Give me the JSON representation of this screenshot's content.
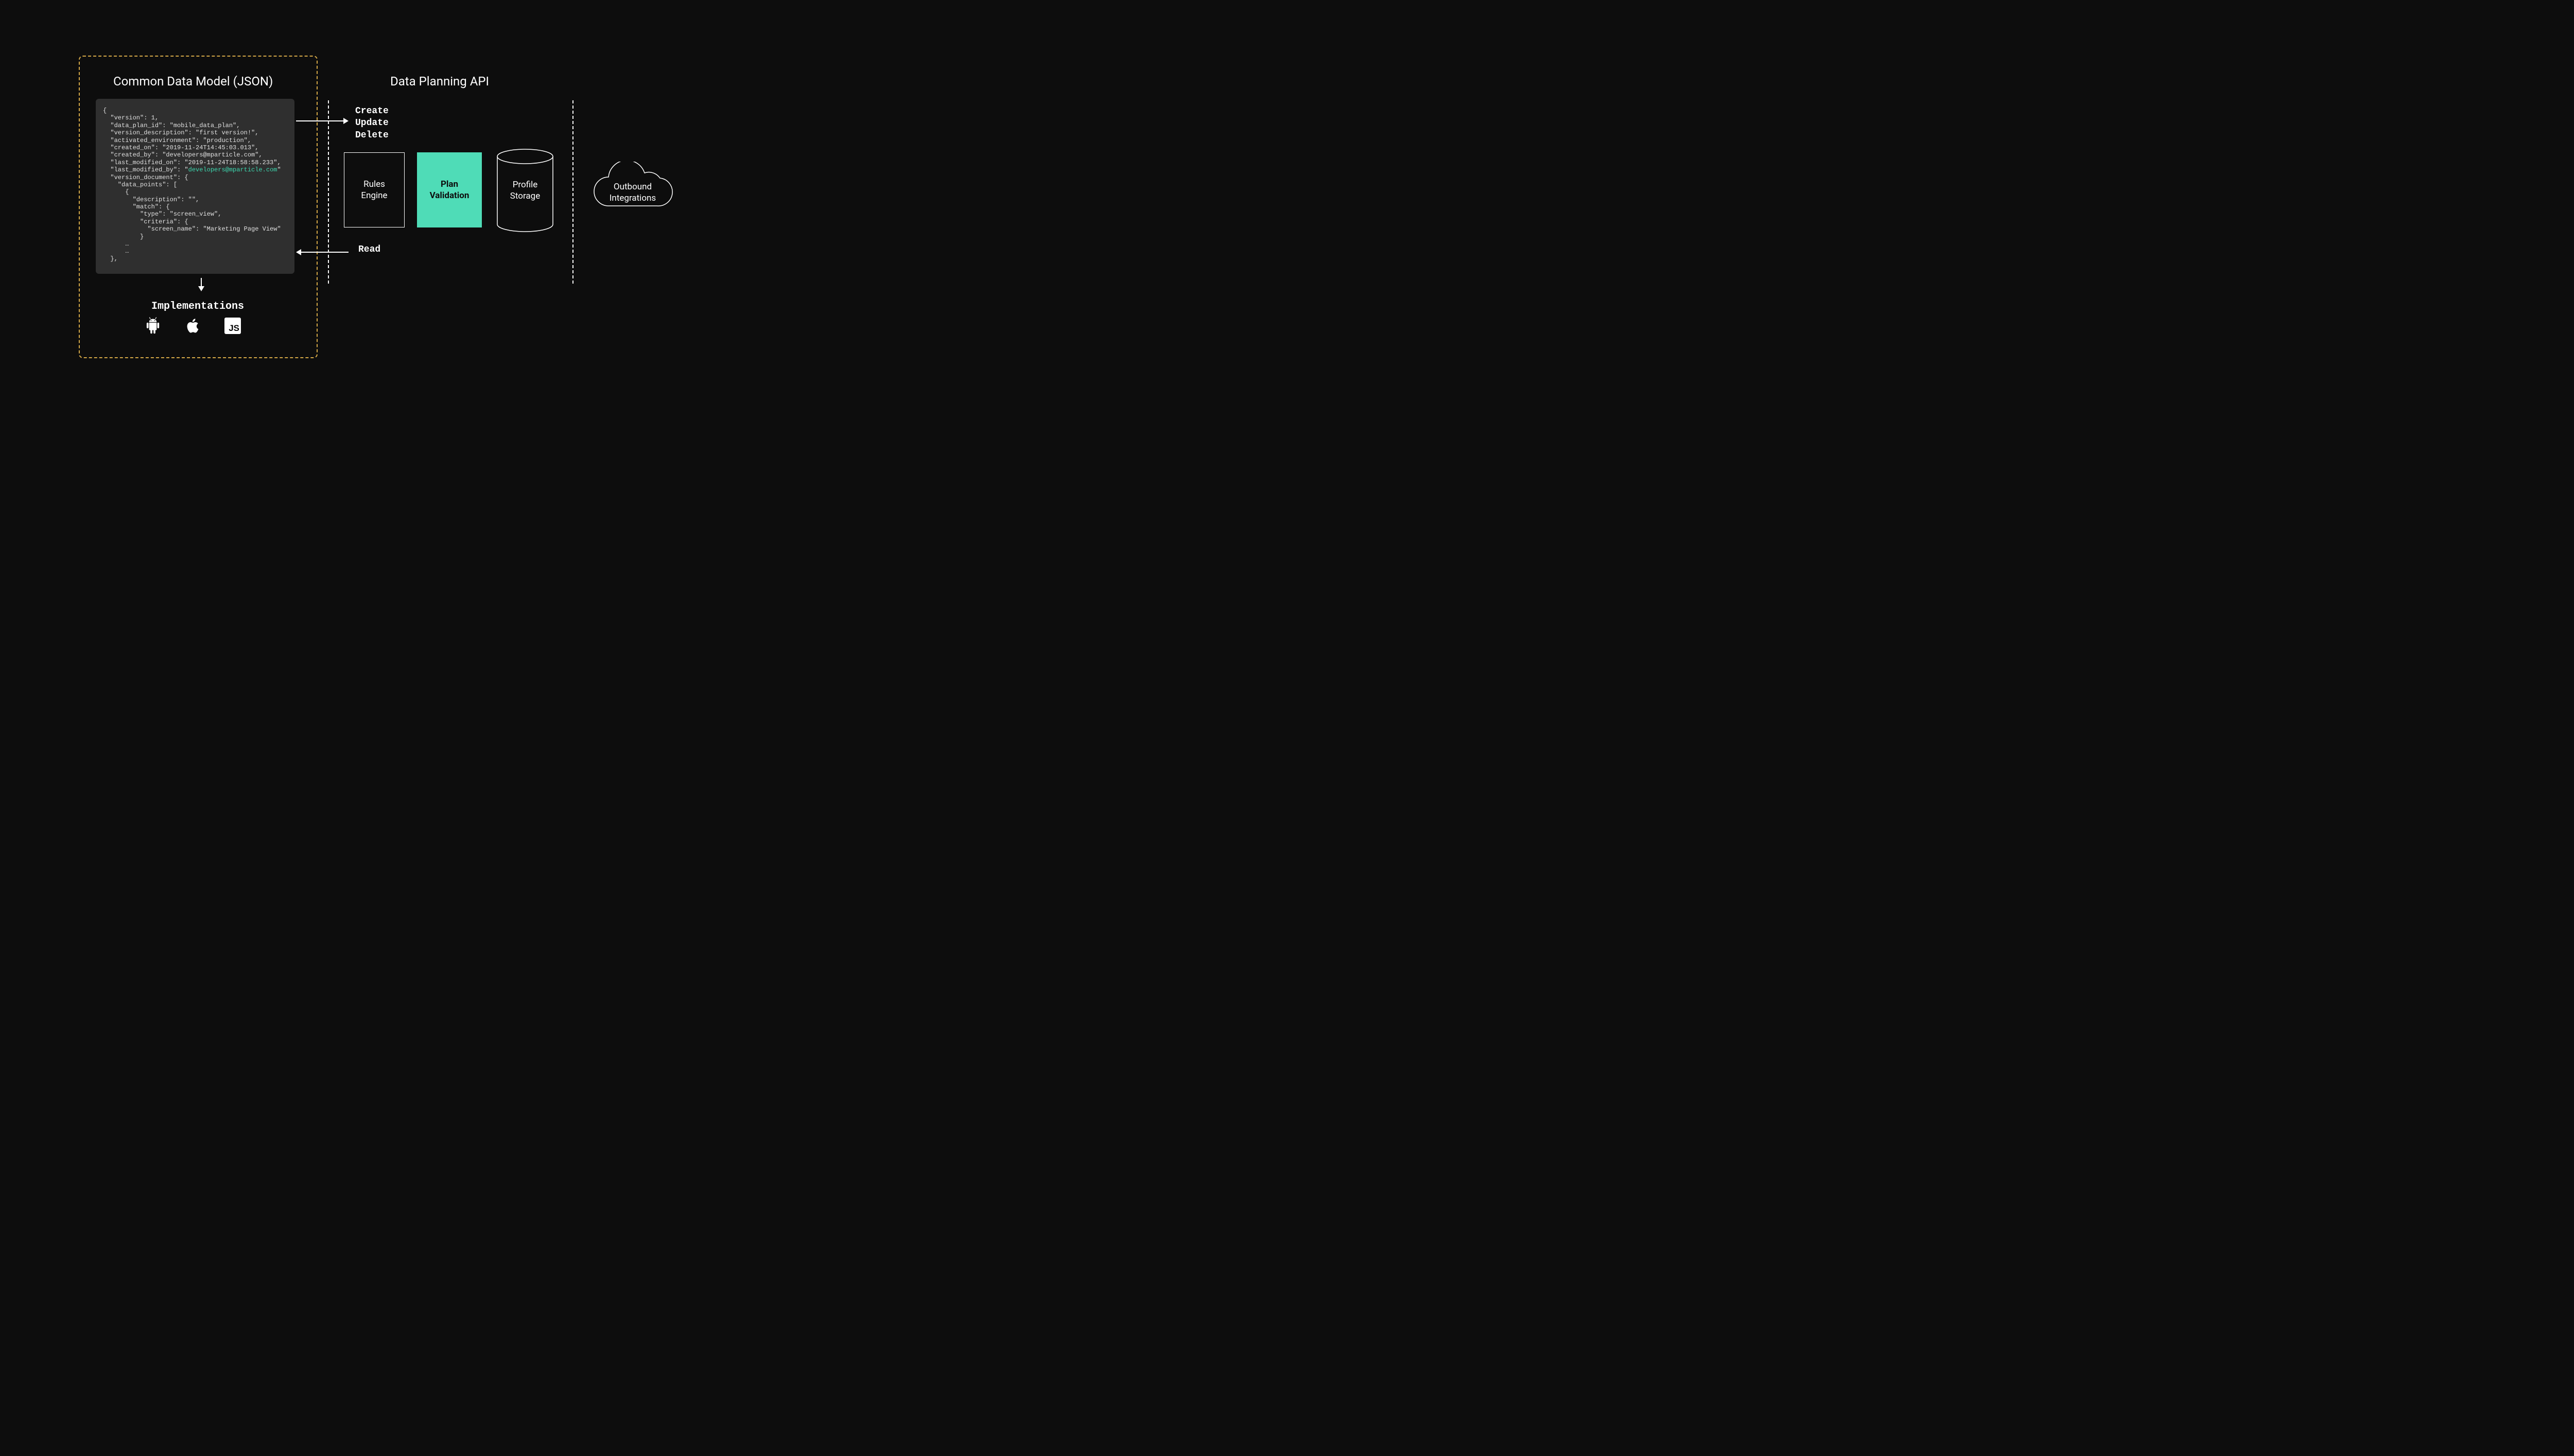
{
  "titles": {
    "cdm": "Common Data Model (JSON)",
    "api": "Data Planning API",
    "implementations": "Implementations"
  },
  "json_model": {
    "line0": "{",
    "line1": "  \"version\": 1,",
    "line2": "  \"data_plan_id\": \"mobile_data_plan\",",
    "line3": "  \"version_description\": \"first version!\",",
    "line4": "  \"activated_environment\": \"production\",",
    "line5": "  \"created_on\": \"2019-11-24T14:45:03.013\",",
    "line6": "  \"created_by\": \"developers@mparticle.com\",",
    "line7": "  \"last_modified_on\": \"2019-11-24T18:58:58.233\",",
    "line8a": "  \"last_modified_by\": \"",
    "line8b": "developers@mparticle.com",
    "line8c": "\"",
    "line9": "  \"version_document\": {",
    "line10": "    \"data_points\": [",
    "line11": "      {",
    "line12": "        \"description\": \"\",",
    "line13": "        \"match\": {",
    "line14": "          \"type\": \"screen_view\",",
    "line15": "          \"criteria\": {",
    "line16": "            \"screen_name\": \"Marketing Page View\"",
    "line17": "          }",
    "line18": "      …",
    "line19": "      …",
    "line20": "  },"
  },
  "actions": {
    "create": "Create",
    "update": "Update",
    "delete": "Delete",
    "read": "Read"
  },
  "boxes": {
    "rules": "Rules\nEngine",
    "plan": "Plan\nValidation",
    "profile": "Profile\nStorage",
    "outbound": "Outbound\nIntegrations"
  },
  "icons": {
    "android": "android-icon",
    "apple": "apple-icon",
    "js": "JS"
  }
}
